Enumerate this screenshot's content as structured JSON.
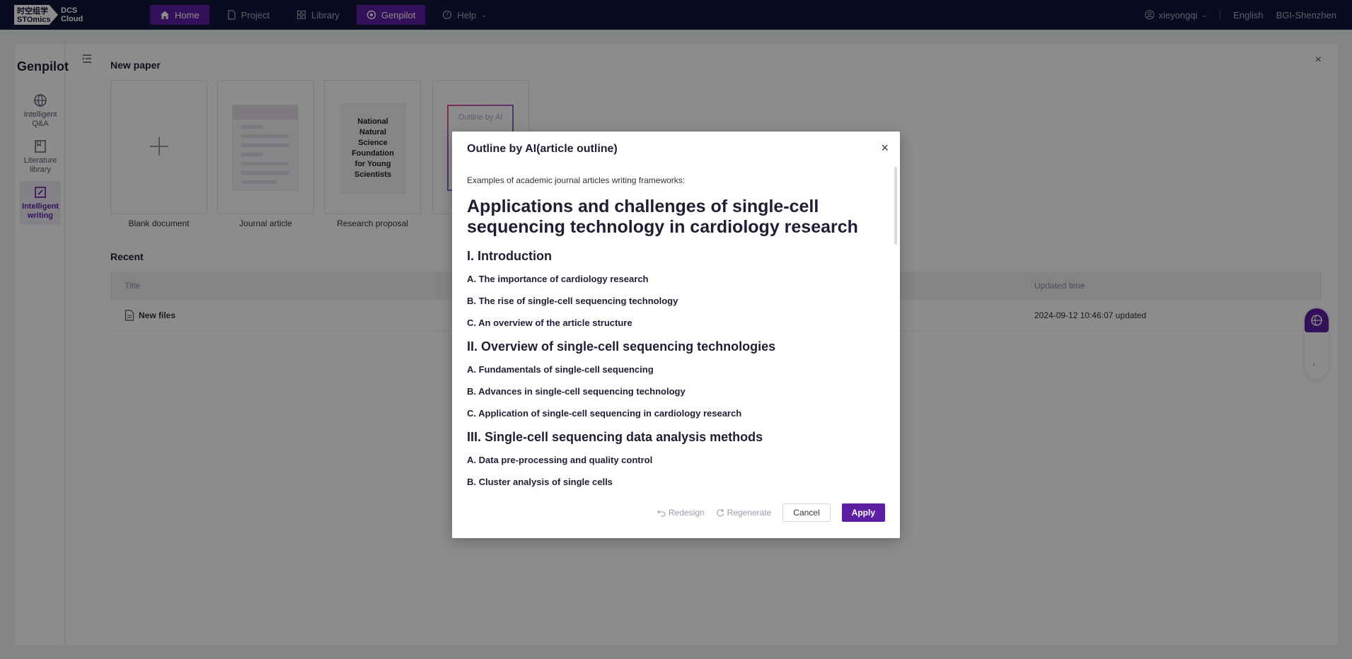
{
  "topbar": {
    "logo_line1": "时空组学",
    "logo_line2": "STOmics",
    "logo_text1": "DCS",
    "logo_text2": "Cloud",
    "nav": [
      {
        "label": "Home",
        "icon": "home-icon"
      },
      {
        "label": "Project",
        "icon": "file-icon"
      },
      {
        "label": "Library",
        "icon": "grid-icon"
      },
      {
        "label": "Genpilot",
        "icon": "genpilot-icon"
      },
      {
        "label": "Help",
        "icon": "help-icon"
      }
    ],
    "user": "xieyongqi",
    "language": "English",
    "region": "BGI-Shenzhen"
  },
  "sidebar": {
    "title": "Genpilot",
    "items": [
      {
        "label": "Intelligent Q&A",
        "icon": "globe-icon"
      },
      {
        "label": "Literature library",
        "icon": "book-icon"
      },
      {
        "label": "Intelligent writing",
        "icon": "edit-icon"
      }
    ]
  },
  "new_paper": {
    "title": "New paper",
    "templates": [
      {
        "label": "Blank document"
      },
      {
        "label": "Journal article"
      },
      {
        "label": "Research proposal",
        "thumb_text": "National Natural Science Foundation for Young Scientists"
      },
      {
        "label": "Outline by AI",
        "thumb_text": "Outline by AI"
      }
    ]
  },
  "recent": {
    "title": "Recent",
    "columns": [
      "Title",
      "Updated time"
    ],
    "rows": [
      {
        "title": "New files",
        "updated": "2024-09-12 10:46:07 updated"
      }
    ]
  },
  "dialog": {
    "title": "Outline by AI(article outline)",
    "intro": "Examples of academic journal articles writing frameworks:",
    "heading": "Applications and challenges of single-cell sequencing technology in cardiology research",
    "sections": [
      {
        "title": "I. Introduction",
        "items": [
          "A. The importance of cardiology research",
          "B. The rise of single-cell sequencing technology",
          "C. An overview of the article structure"
        ]
      },
      {
        "title": "II. Overview of single-cell sequencing technologies",
        "items": [
          "A. Fundamentals of single-cell sequencing",
          "B. Advances in single-cell sequencing technology",
          "C. Application of single-cell sequencing in cardiology research"
        ]
      },
      {
        "title": "III. Single-cell sequencing data analysis methods",
        "items": [
          "A. Data pre-processing and quality control",
          "B. Cluster analysis of single cells"
        ]
      }
    ],
    "buttons": {
      "redesign": "Redesign",
      "regenerate": "Regenerate",
      "cancel": "Cancel",
      "apply": "Apply"
    }
  }
}
